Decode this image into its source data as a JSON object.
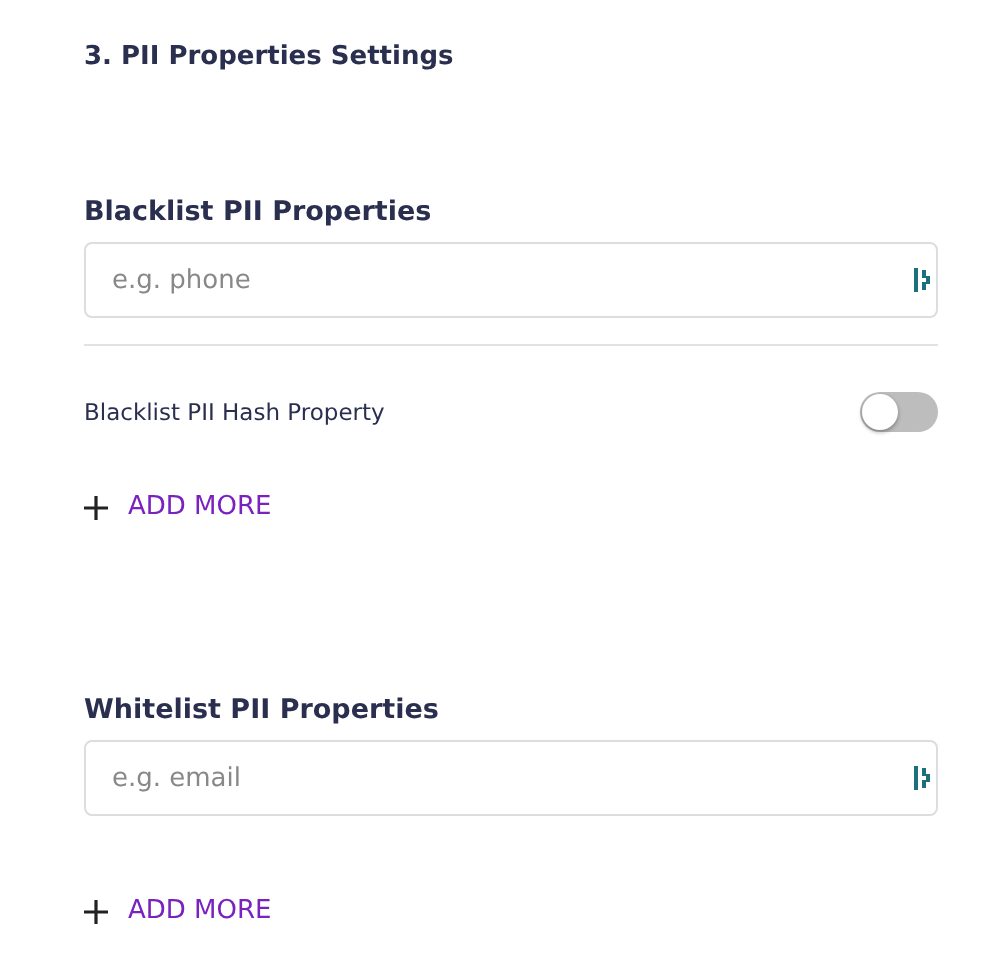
{
  "title": "3. PII Properties Settings",
  "sections": [
    {
      "label": "Blacklist PII Properties",
      "placeholder": "e.g. phone",
      "toggles": [
        {
          "label": "Blacklist PII Hash Property",
          "on": false
        }
      ],
      "add_label": "ADD MORE"
    },
    {
      "label": "Whitelist PII Properties",
      "placeholder": "e.g. email",
      "add_label": "ADD MORE"
    }
  ]
}
